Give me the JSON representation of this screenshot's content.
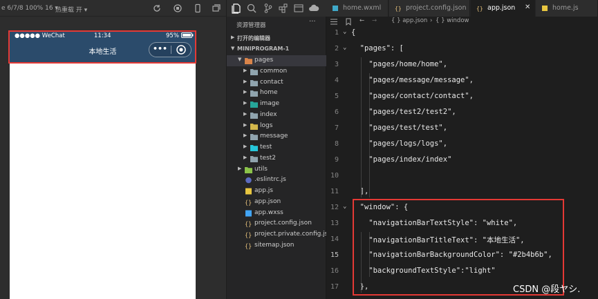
{
  "simulator": {
    "device_info": "e 6/7/8 100% 16 ▾",
    "reload_label": "热重载 开 ▾",
    "status_bar": {
      "carrier": "●●●●● WeChat",
      "time": "11:34",
      "battery": "95%"
    },
    "navbar": {
      "title": "本地生活",
      "background_color": "#2b4b6b",
      "text_color": "#ffffff",
      "more_glyph": "•••"
    }
  },
  "explorer": {
    "header": "资源管理器",
    "more_glyph": "···",
    "open_editors": "打开的编辑器",
    "project": "MINIPROGRAM-1",
    "items": [
      {
        "label": "pages",
        "type": "folder-open",
        "depth": 1,
        "selected": true
      },
      {
        "label": "common",
        "type": "folder",
        "depth": 2
      },
      {
        "label": "contact",
        "type": "folder",
        "depth": 2
      },
      {
        "label": "home",
        "type": "folder",
        "depth": 2
      },
      {
        "label": "image",
        "type": "folder-image",
        "depth": 2
      },
      {
        "label": "index",
        "type": "folder",
        "depth": 2
      },
      {
        "label": "logs",
        "type": "folder-yellow",
        "depth": 2
      },
      {
        "label": "message",
        "type": "folder",
        "depth": 2
      },
      {
        "label": "test",
        "type": "folder-test",
        "depth": 2
      },
      {
        "label": "test2",
        "type": "folder",
        "depth": 2
      },
      {
        "label": "utils",
        "type": "folder-green",
        "depth": 1
      },
      {
        "label": ".eslintrc.js",
        "type": "file-eslint",
        "depth": 1
      },
      {
        "label": "app.js",
        "type": "file-js",
        "depth": 1
      },
      {
        "label": "app.json",
        "type": "file-json",
        "depth": 1
      },
      {
        "label": "app.wxss",
        "type": "file-wxss",
        "depth": 1
      },
      {
        "label": "project.config.json",
        "type": "file-json",
        "depth": 1
      },
      {
        "label": "project.private.config.js...",
        "type": "file-json",
        "depth": 1
      },
      {
        "label": "sitemap.json",
        "type": "file-json",
        "depth": 1
      }
    ]
  },
  "editor": {
    "tabs": [
      {
        "label": "home.wxml",
        "icon": "file-wxml",
        "active": false
      },
      {
        "label": "project.config.json",
        "icon": "file-json",
        "active": false
      },
      {
        "label": "app.json",
        "icon": "file-json",
        "active": true,
        "close_glyph": "✕"
      },
      {
        "label": "home.js",
        "icon": "file-js",
        "active": false
      }
    ],
    "breadcrumb": {
      "file": "{ } app.json",
      "separator": "›",
      "node": "{ } window"
    },
    "current_line": 15,
    "lines": [
      {
        "n": "1",
        "text": "{"
      },
      {
        "n": "2",
        "text": "  \"pages\": ["
      },
      {
        "n": "3",
        "text": "    \"pages/home/home\","
      },
      {
        "n": "4",
        "text": "    \"pages/message/message\","
      },
      {
        "n": "5",
        "text": "    \"pages/contact/contact\","
      },
      {
        "n": "6",
        "text": "    \"pages/test2/test2\","
      },
      {
        "n": "7",
        "text": "    \"pages/test/test\","
      },
      {
        "n": "8",
        "text": "    \"pages/logs/logs\","
      },
      {
        "n": "9",
        "text": "    \"pages/index/index\""
      },
      {
        "n": "10",
        "text": ""
      },
      {
        "n": "11",
        "text": "  ],"
      },
      {
        "n": "12",
        "text": "  \"window\": {"
      },
      {
        "n": "13",
        "text": "    \"navigationBarTextStyle\": \"white\","
      },
      {
        "n": "14",
        "text": "    \"navigationBarTitleText\": \"本地生活\","
      },
      {
        "n": "15",
        "text": "    \"navigationBarBackgroundColor\": \"#2b4b6b\","
      },
      {
        "n": "16",
        "text": "    \"backgroundTextStyle\":\"light\""
      },
      {
        "n": "17",
        "text": "  },"
      }
    ]
  },
  "watermark": "CSDN @段ヤシ.",
  "colors": {
    "highlight": "#e53935",
    "accent_json": "#e5c07b"
  }
}
